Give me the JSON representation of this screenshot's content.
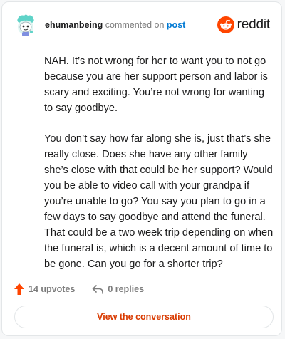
{
  "header": {
    "username": "ehumanbeing",
    "action_text": "commented on",
    "post_link": "post",
    "logo_text": "reddit"
  },
  "comment": {
    "paragraphs": [
      "NAH. It’s not wrong for her to want you to not go because you are her support person and labor is scary and exciting. You’re not wrong for wanting to say goodbye.",
      "You don’t say how far along she is, just that’s she really close. Does she have any other family she’s close with that could be her support? Would you be able to video call with your grandpa if you’re unable to go? You say you plan to go in a few days to say goodbye and attend the funeral. That could be a two week trip depending on when the funeral is, which is a decent amount of time to be gone. Can you go for a shorter trip?"
    ]
  },
  "footer": {
    "upvotes": "14 upvotes",
    "replies": "0 replies",
    "view_button": "View the conversation"
  },
  "colors": {
    "accent": "#ff4500",
    "link": "#0079d3",
    "button_text": "#d93a00",
    "muted": "#7c7c7c",
    "avatar_teal": "#5fd3c8"
  },
  "icons": [
    "snoo-avatar-icon",
    "reddit-logo-icon",
    "upvote-arrow-icon",
    "reply-arrow-icon"
  ]
}
